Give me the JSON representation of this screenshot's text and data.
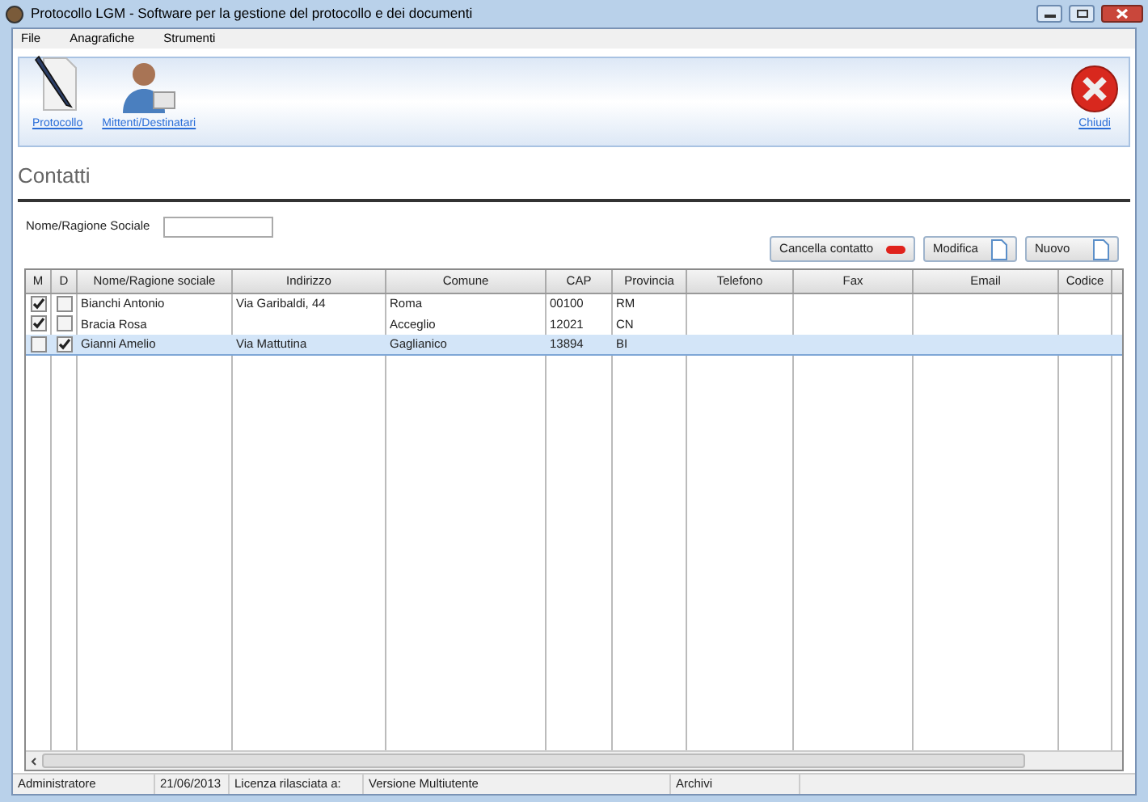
{
  "window": {
    "title": "Protocollo LGM - Software per la gestione del protocollo e dei documenti"
  },
  "menu": [
    "File",
    "Anagrafiche",
    "Strumenti"
  ],
  "toolbar": {
    "items": [
      {
        "label": "Protocollo",
        "kind": "document"
      },
      {
        "label": "Mittenti/Destinatari",
        "kind": "person"
      }
    ],
    "close": {
      "label": "Chiudi"
    }
  },
  "heading": "Contatti",
  "search": {
    "label": "Nome/Ragione Sociale"
  },
  "buttons": [
    {
      "label": "Cancella contatto",
      "kind": "delete"
    },
    {
      "label": "Modifica",
      "kind": "page"
    },
    {
      "label": "Nuovo",
      "kind": "page"
    }
  ],
  "table": {
    "columns": [
      "M",
      "D",
      "Nome/Ragione sociale",
      "Indirizzo",
      "Comune",
      "CAP",
      "Provincia",
      "Telefono",
      "Fax",
      "Email",
      "Codice"
    ],
    "rows": [
      {
        "m_checked": true,
        "d_checked": false,
        "selected": false,
        "nome": "Bianchi Antonio",
        "indirizzo": "Via Garibaldi, 44",
        "comune": "Roma",
        "cap": "00100",
        "provincia": "RM"
      },
      {
        "m_checked": true,
        "d_checked": false,
        "selected": false,
        "nome": "Bracia Rosa",
        "comune": "Acceglio",
        "cap": "12021",
        "provincia": "CN"
      },
      {
        "m_checked": false,
        "d_checked": true,
        "selected": true,
        "nome": "Gianni Amelio",
        "indirizzo": "Via Mattutina",
        "comune": "Gaglianico",
        "cap": "13894",
        "provincia": "BI"
      }
    ]
  },
  "status_bar": [
    "Administratore",
    "21/06/2013",
    "Licenza rilasciata a:",
    "Versione Multiutente",
    "Archivi"
  ]
}
